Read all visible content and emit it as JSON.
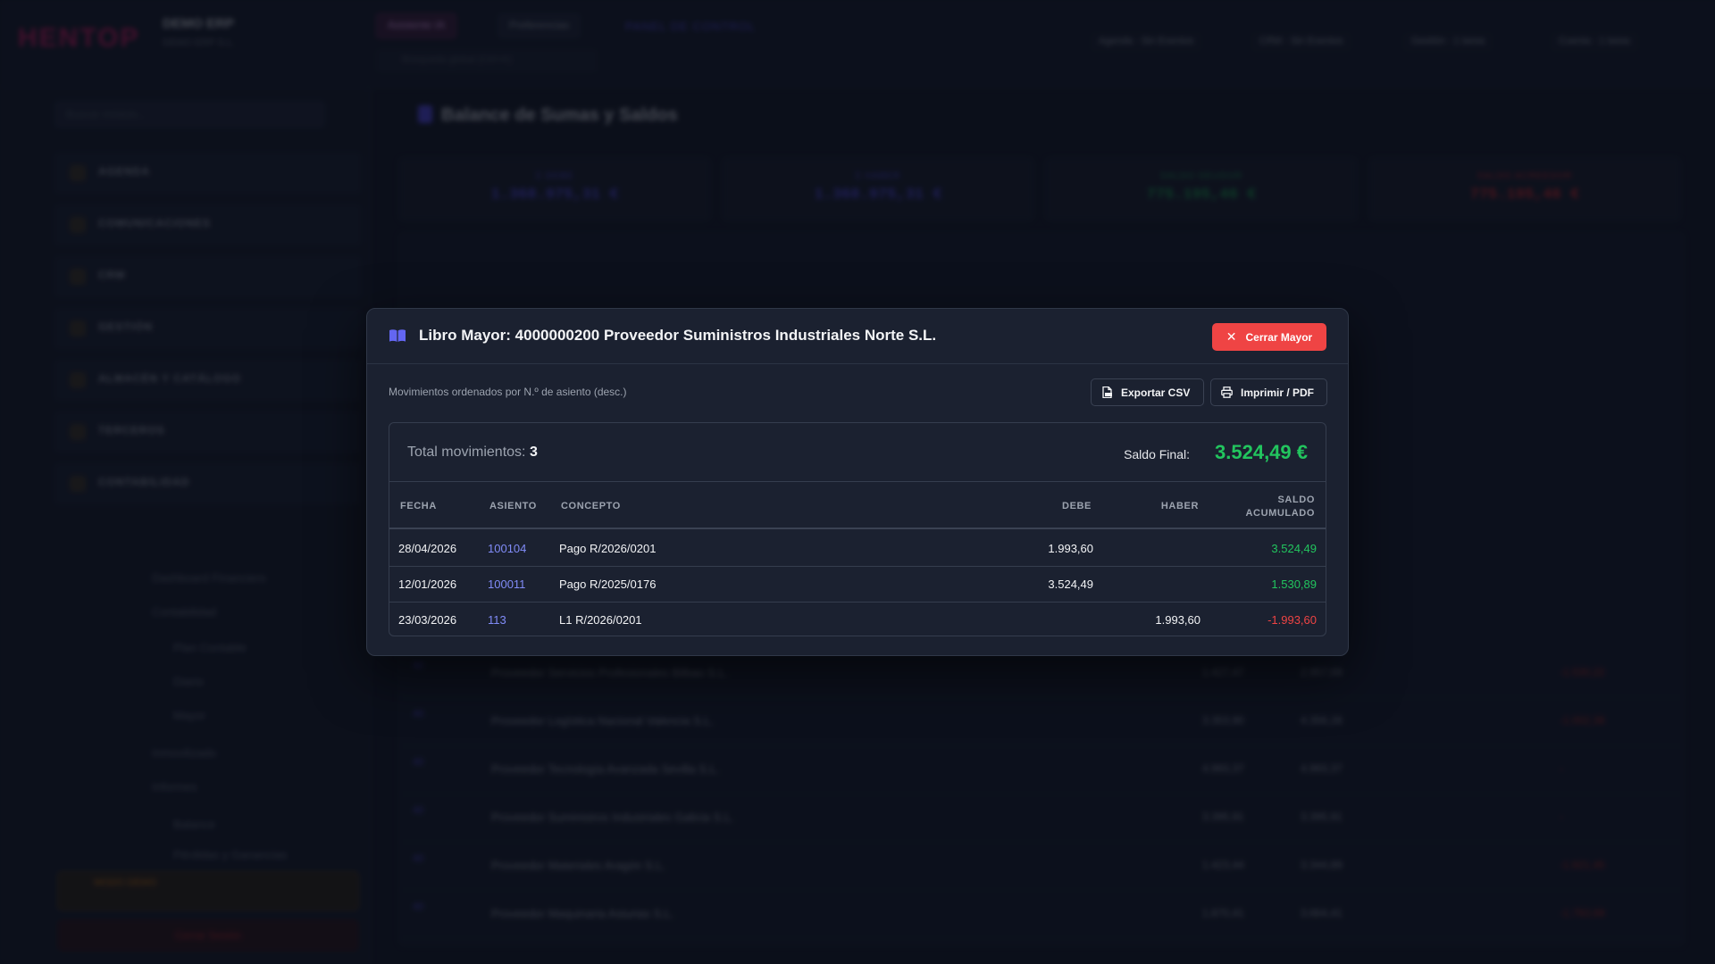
{
  "background": {
    "logo": "HENTOP",
    "brand_name": "DEMO ERP",
    "brand_sub": "DEMO ERP S.L.",
    "topbar": {
      "active_tab": "Asistente IA",
      "prefs_tab": "Preferencias",
      "search_placeholder": "Búsqueda global (Ctrl+K)",
      "panel_link": "PANEL DE CONTROL",
      "chips": [
        "Agenda · Sin Eventos",
        "CRM · Sin Eventos",
        "Gestión · 1 tarea",
        "Cuenta · 1 tarea"
      ]
    },
    "sidebar": {
      "search_placeholder": "Buscar módulo...",
      "items": [
        "AGENDA",
        "COMUNICACIONES",
        "CRM",
        "GESTIÓN",
        "ALMACÉN Y CATÁLOGO",
        "TERCEROS",
        "CONTABILIDAD"
      ],
      "subitems": [
        "Dashboard Financiero",
        "Contabilidad",
        "Plan Contable",
        "Diario",
        "Mayor",
        "Inmovilizado",
        "Informes",
        "Balance",
        "Pérdidas y Ganancias"
      ],
      "demo_label": "MODO DEMO",
      "logout": "Cerrar Sesión"
    },
    "content": {
      "title": "Balance de Sumas y Saldos",
      "kpis": [
        {
          "label": "Σ DEBE",
          "value": "1.368.975,31 €",
          "color": "#4f46e5"
        },
        {
          "label": "Σ HABER",
          "value": "1.368.975,31 €",
          "color": "#4f46e5"
        },
        {
          "label": "SALDO DEUDOR",
          "value": "775.195,46 €",
          "color": "#16a34a"
        },
        {
          "label": "SALDO ACREEDOR",
          "value": "775.195,46 €",
          "color": "#dc2626"
        }
      ],
      "rows": [
        {
          "code": "40",
          "name": "Proveedor Servicios Profesionales Bilbao S.L.",
          "debe": "1.427,47",
          "haber": "2.957,69",
          "saldo": "-1.530,22"
        },
        {
          "code": "40",
          "name": "Proveedor Logística Nacional Valencia S.L.",
          "debe": "3.353,90",
          "haber": "4.356,28",
          "saldo": "-1.002,38"
        },
        {
          "code": "40",
          "name": "Proveedor Tecnología Avanzada Sevilla S.L.",
          "debe": "4.993,37",
          "haber": "4.993,37",
          "saldo": "-"
        },
        {
          "code": "40",
          "name": "Proveedor Suministros Industriales Galicia S.L.",
          "debe": "3.395,91",
          "haber": "3.395,91",
          "saldo": "-"
        },
        {
          "code": "40",
          "name": "Proveedor Materiales Aragón S.L.",
          "debe": "1.423,44",
          "haber": "3.344,89",
          "saldo": "-1.921,45"
        },
        {
          "code": "40",
          "name": "Proveedor Maquinaria Asturias S.L.",
          "debe": "1.870,41",
          "haber": "3.664,41",
          "saldo": "-1.793,99"
        }
      ]
    }
  },
  "modal": {
    "title": "Libro Mayor: 4000000200 Proveedor Suministros Industriales Norte S.L.",
    "close_label": "Cerrar Mayor",
    "subtitle": "Movimientos ordenados por N.º de asiento (desc.)",
    "export_csv": "Exportar CSV",
    "print_pdf": "Imprimir / PDF",
    "total_label": "Total movimientos:",
    "total_value": "3",
    "saldo_label": "Saldo Final:",
    "saldo_value": "3.524,49 €",
    "columns": {
      "fecha": "FECHA",
      "asiento": "ASIENTO",
      "concepto": "CONCEPTO",
      "debe": "DEBE",
      "haber": "HABER",
      "saldo_line1": "SALDO",
      "saldo_line2": "ACUMULADO"
    },
    "rows": [
      {
        "fecha": "28/04/2026",
        "asiento": "100104",
        "concepto": "Pago R/2026/0201",
        "debe": "1.993,60",
        "haber": "",
        "saldo": "3.524,49",
        "sign": "pos"
      },
      {
        "fecha": "12/01/2026",
        "asiento": "100011",
        "concepto": "Pago R/2025/0176",
        "debe": "3.524,49",
        "haber": "",
        "saldo": "1.530,89",
        "sign": "pos"
      },
      {
        "fecha": "23/03/2026",
        "asiento": "113",
        "concepto": "L1 R/2026/0201",
        "debe": "",
        "haber": "1.993,60",
        "saldo": "-1.993,60",
        "sign": "neg"
      }
    ],
    "colors": {
      "accent": "#6366f1",
      "danger": "#ef4444",
      "positive": "#22c55e"
    }
  }
}
